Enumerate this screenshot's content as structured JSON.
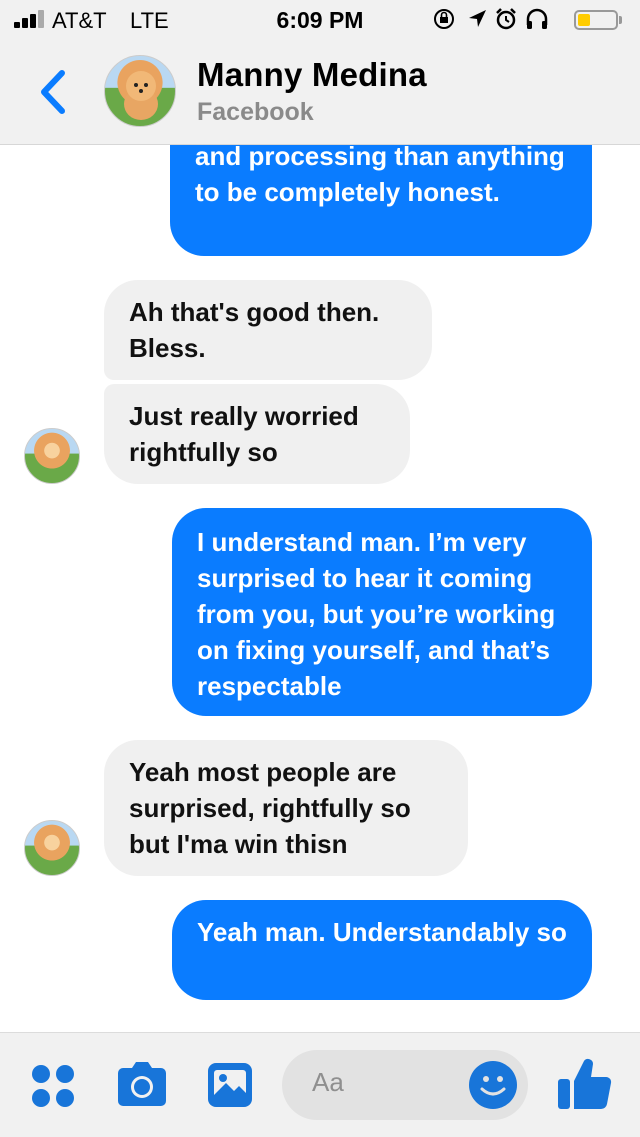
{
  "status_bar": {
    "carrier": "AT&T",
    "network": "LTE",
    "time": "6:09 PM",
    "battery_level": 0.25
  },
  "header": {
    "back_icon": "chevron-left-icon",
    "contact_name": "Manny Medina",
    "subtitle": "Facebook"
  },
  "messages": [
    {
      "direction": "outgoing",
      "text": "and processing than anything to be completely honest."
    },
    {
      "direction": "incoming",
      "text": "Ah that's good then. Bless."
    },
    {
      "direction": "incoming",
      "text": "Just really worried rightfully so"
    },
    {
      "direction": "outgoing",
      "text": "I understand man. I’m very surprised to hear it coming from you, but  you’re working on fixing yourself, and that’s respectable"
    },
    {
      "direction": "incoming",
      "text": "Yeah most people are surprised, rightfully so but I'ma win thisn"
    },
    {
      "direction": "outgoing",
      "text": "Yeah man. Understandably so"
    }
  ],
  "composer": {
    "placeholder": "Aa",
    "icons": [
      "menu-dots-icon",
      "camera-icon",
      "photo-icon",
      "emoji-icon",
      "thumbs-up-icon"
    ]
  },
  "colors": {
    "accent": "#0a7cff",
    "icon_blue": "#1875d9",
    "incoming_bubble": "#f0f0f0",
    "bar_background": "#f1f1f1"
  }
}
